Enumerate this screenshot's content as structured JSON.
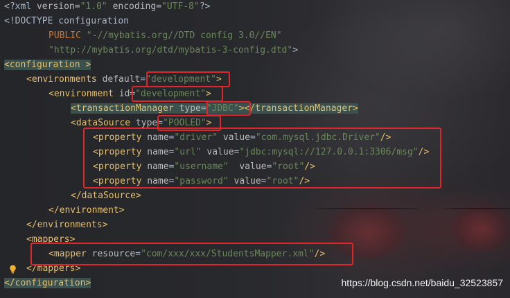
{
  "code_lines": {
    "l1": {
      "p1": "<?xml ",
      "a1": "version",
      "p2": "=",
      "v1": "\"1.0\"",
      "p3": " ",
      "a2": "encoding",
      "p4": "=",
      "v2": "\"UTF-8\"",
      "p5": "?>"
    },
    "l2": {
      "text": "<!DOCTYPE configuration"
    },
    "l3": {
      "kw": "PUBLIC",
      "val": "\"-//mybatis.org//DTD config 3.0//EN\""
    },
    "l4": {
      "val": "\"http://mybatis.org/dtd/mybatis-3-config.dtd\"",
      "end": ">"
    },
    "l5": {
      "tag": "<configuration >"
    },
    "l6": {
      "tag": "<environments",
      "attr": " default",
      "eq": "=",
      "val": "\"development\"",
      "end": ">"
    },
    "l7": {
      "tag": "<environment",
      "attr": " id",
      "eq": "=",
      "val": "\"development\"",
      "end": ">"
    },
    "l8": {
      "tag": "<transactionManager",
      "attr": " type",
      "eq": "=",
      "val": "\"JDBC\"",
      "end": "></transactionManager>"
    },
    "l9": {
      "tag": "<dataSource",
      "attr": " type",
      "eq": "=",
      "val": "\"POOLED\"",
      "end": ">"
    },
    "l10": {
      "tag": "<property",
      "a1": " name",
      "v1": "\"driver\"",
      "a2": " value",
      "v2": "\"com.mysql.jdbc.Driver\"",
      "end": "/>"
    },
    "l11": {
      "tag": "<property",
      "a1": " name",
      "v1": "\"url\"",
      "a2": " value",
      "v2": "\"jdbc:mysql://127.0.0.1:3306/msg\"",
      "end": "/>"
    },
    "l12": {
      "tag": "<property",
      "a1": " name",
      "v1": "\"username\"",
      "a2": "  value",
      "v2": "\"root\"",
      "end": "/>"
    },
    "l13": {
      "tag": "<property",
      "a1": " name",
      "v1": "\"password\"",
      "a2": " value",
      "v2": "\"root\"",
      "end": "/>"
    },
    "l14": {
      "tag": "</dataSource>"
    },
    "l15": {
      "tag": "</environment>"
    },
    "l16": {
      "tag": "</environments>"
    },
    "l17": {
      "tag": "<mappers>"
    },
    "l18": {
      "tag": "<mapper",
      "attr": " resource",
      "eq": "=",
      "val": "\"com/xxx/xxx/StudentsMapper.xml\"",
      "end": "/>"
    },
    "l19": {
      "tag": "</mappers>"
    },
    "l20": {
      "tag": "</configuration>"
    }
  },
  "eq": "=",
  "watermark": "https://blog.csdn.net/baidu_32523857",
  "colors": {
    "tag": "#e8bf6a",
    "value": "#6a8759",
    "attribute": "#bababa",
    "keyword": "#cc7832",
    "highlight_box": "#e0262a"
  },
  "icons": {
    "intention": "lightbulb-icon"
  }
}
